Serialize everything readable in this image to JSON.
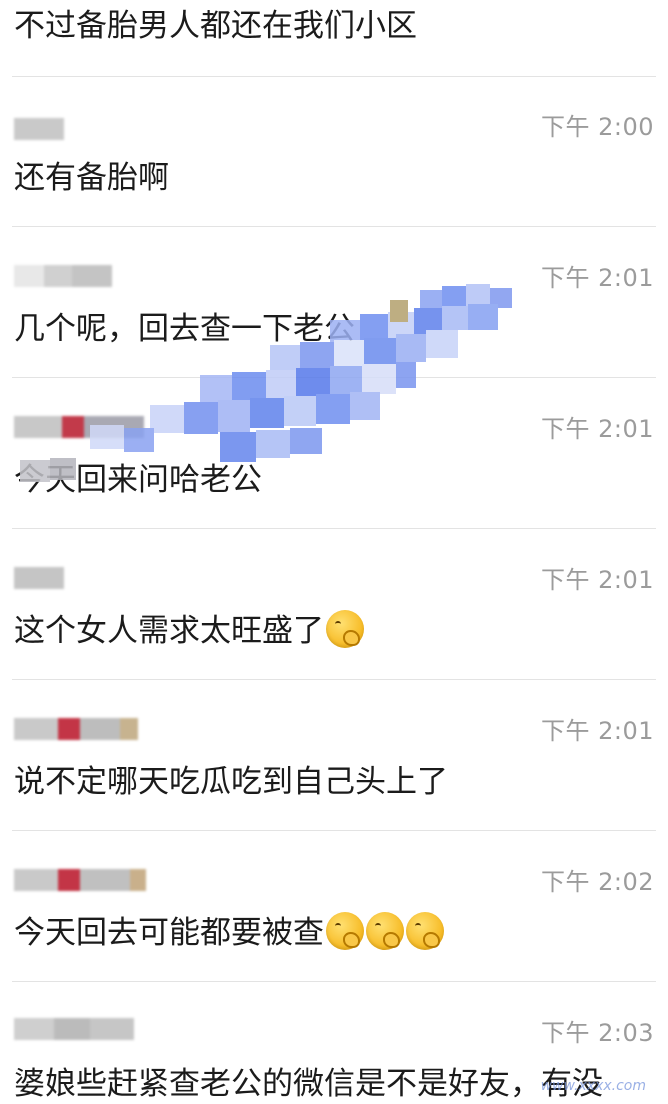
{
  "top_message": "不过备胎男人都还在我们小区",
  "messages": [
    {
      "time": "下午 2:00",
      "text": "还有备胎啊",
      "emoji_count": 0
    },
    {
      "time": "下午 2:01",
      "text": "几个呢，回去查一下老公",
      "emoji_count": 0
    },
    {
      "time": "下午 2:01",
      "text": "今天回来问哈老公",
      "emoji_count": 0
    },
    {
      "time": "下午 2:01",
      "text": "这个女人需求太旺盛了",
      "emoji_count": 1
    },
    {
      "time": "下午 2:01",
      "text": "说不定哪天吃瓜吃到自己头上了",
      "emoji_count": 0
    },
    {
      "time": "下午 2:02",
      "text": "今天回去可能都要被查",
      "emoji_count": 3
    },
    {
      "time": "下午 2:03",
      "text": "婆娘些赶紧查老公的微信是不是好友，有没",
      "emoji_count": 0
    }
  ],
  "emoji_name": "thinking-face",
  "watermark": "www.xxxx.com",
  "colors": {
    "text": "#1b1b1b",
    "time": "#9b9b9b",
    "divider": "#e3e3e3",
    "mosaic_blue": "#6f8ff0"
  }
}
